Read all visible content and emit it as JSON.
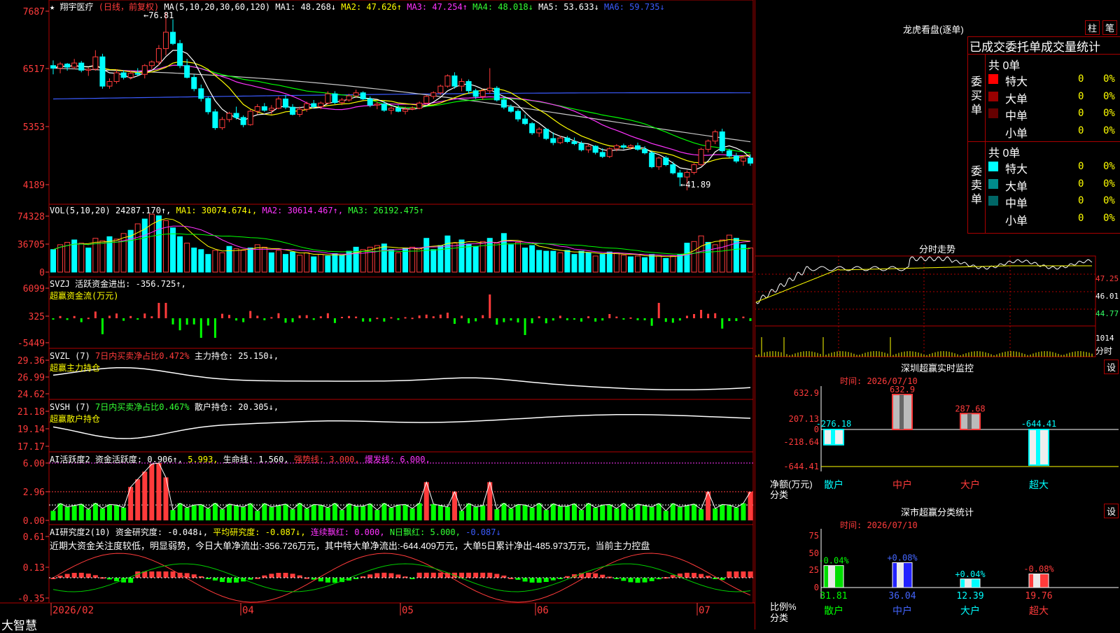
{
  "stock": {
    "name": "翔宇医疗",
    "period": "(日线，前复权)",
    "ma_label": "MA(5,10,20,30,60,120)",
    "ma1": "MA1: 48.268↓",
    "ma2": "MA2: 47.626↑",
    "ma3": "MA3: 47.254↑",
    "ma4": "MA4: 48.018↓",
    "ma5": "MA5: 53.633↓",
    "ma6": "MA6: 59.735↓",
    "high_mark": "←76.81",
    "low_mark": "←41.89"
  },
  "ui": {
    "axis_labels": {
      "price": [
        "7687",
        "6517",
        "5353",
        "4189"
      ],
      "vol": [
        "74328",
        "36705",
        "0"
      ],
      "svzj": [
        "6099",
        "325",
        "-5449"
      ],
      "svzl": [
        "29.36",
        "26.99",
        "24.62"
      ],
      "svsh": [
        "21.18",
        "19.14",
        "17.17"
      ],
      "ai1": [
        "6.00",
        "2.96",
        "0.00"
      ],
      "ai2": [
        "0.61",
        "0.13",
        "-0.35"
      ]
    },
    "date_labels": [
      "2026/02",
      "04",
      "05",
      "06",
      "07"
    ],
    "logo": "大智慧"
  },
  "vol_header": {
    "label": "VOL(5,10,20)",
    "val": "24287.170↑,",
    "ma1": "MA1: 30074.674↓,",
    "ma2": "MA2: 30614.467↑,",
    "ma3": "MA3: 26192.475↑"
  },
  "svzj_header": {
    "label": "SVZJ",
    "text": "活跃资金进出: -356.725↑,",
    "sub": "超赢资金流(万元)"
  },
  "svzl_header": {
    "label": "SVZL (7)",
    "ratio": "7日内买卖净占比0.472%",
    "text": "主力持仓: 25.150↓,",
    "sub": "超赢主力持仓"
  },
  "svsh_header": {
    "label": "SVSH (7)",
    "ratio": "7日内买卖净占比0.467%",
    "text": "散户持仓: 20.305↓,",
    "sub": "超赢散户持仓"
  },
  "ai1_header": {
    "label": "AI活跃度2",
    "text": "资金活跃度: 0.906↑,",
    "val2": "5.993,",
    "life": "生命线: 1.560,",
    "strong": "强势线: 3.000,",
    "burst": "爆发线: 6.000,"
  },
  "ai2_header": {
    "label": "AI研究度2(10)",
    "text": "资金研究度: -0.048↓,",
    "avg": "平均研究度: -0.087↓,",
    "lx": "连续飘红: 0.000,",
    "nd": "N日飘红: 5.000,",
    "last": "-0.087↓",
    "comment": "近期大资金关注度较低，明显弱势，今日大单净流出:-356.726万元，其中特大单净流出:-644.409万元，大单5日累计净出-485.973万元，当前主力控盘"
  },
  "right": {
    "lhkp": "龙虎看盘(逐单)",
    "btn_zhu": "柱",
    "btn_bi": "笔",
    "tabs_title": "已成交委托单成交量统计",
    "buy": {
      "side": "委买单",
      "total": "共 0单",
      "rows": [
        {
          "label": "特大",
          "val": "0",
          "pct": "0%",
          "color": "#ff0000"
        },
        {
          "label": "大单",
          "val": "0",
          "pct": "0%",
          "color": "#990000"
        },
        {
          "label": "中单",
          "val": "0",
          "pct": "0%",
          "color": "#660000"
        },
        {
          "label": "小单",
          "val": "0",
          "pct": "0%",
          "color": "#000000"
        }
      ]
    },
    "sell": {
      "side": "委卖单",
      "total": "共 0单",
      "rows": [
        {
          "label": "特大",
          "val": "0",
          "pct": "0%",
          "color": "#00ffff"
        },
        {
          "label": "大单",
          "val": "0",
          "pct": "0%",
          "color": "#008b8b"
        },
        {
          "label": "中单",
          "val": "0",
          "pct": "0%",
          "color": "#006666"
        },
        {
          "label": "小单",
          "val": "0",
          "pct": "0%",
          "color": "#000000"
        }
      ]
    },
    "fs": {
      "title": "分时走势",
      "p1": "47.25",
      "p2": "46.01",
      "p3": "44.77",
      "vol": "1014",
      "unit": "分时"
    },
    "monitor": {
      "title": "深圳超赢实时监控",
      "btn": "设",
      "time": "时间: 2026/07/10",
      "axis": [
        "632.9",
        "207.13",
        "0",
        "-218.64",
        "-644.41"
      ],
      "ylabel": "净额(万元)",
      "xlabel": "分类",
      "cats": [
        "散户",
        "中户",
        "大户",
        "超大"
      ],
      "values": [
        -276.18,
        632.9,
        287.68,
        -644.41
      ],
      "labels": [
        "-276.18",
        "632.9",
        "287.68",
        "-644.41"
      ]
    },
    "classify": {
      "title": "深市超赢分类统计",
      "btn": "设",
      "time": "时间: 2026/07/10",
      "axis": [
        "75",
        "50",
        "25",
        "0"
      ],
      "ylabel": "比例%",
      "xlabel": "分类",
      "cats": [
        "散户",
        "中户",
        "大户",
        "超大"
      ],
      "values": [
        31.81,
        36.04,
        12.39,
        19.76
      ],
      "labels": [
        "31.81",
        "36.04",
        "12.39",
        "19.76"
      ],
      "changes": [
        "-0.04%",
        "+0.08%",
        "+0.04%",
        "-0.08%"
      ]
    }
  },
  "chart_data": {
    "type": "candlestick",
    "ohlc": [
      [
        66.5,
        67.5,
        64.8,
        66.0
      ],
      [
        66.0,
        67.2,
        65.0,
        66.8
      ],
      [
        66.8,
        67.0,
        65.5,
        66.2
      ],
      [
        66.2,
        67.8,
        65.8,
        67.0
      ],
      [
        67.0,
        67.4,
        65.2,
        65.6
      ],
      [
        65.6,
        66.1,
        64.5,
        65.8
      ],
      [
        65.8,
        69.5,
        65.5,
        68.2
      ],
      [
        68.2,
        68.8,
        62.0,
        62.5
      ],
      [
        62.5,
        64.0,
        62.0,
        63.4
      ],
      [
        63.4,
        65.8,
        63.0,
        65.1
      ],
      [
        65.1,
        65.6,
        63.8,
        64.2
      ],
      [
        64.2,
        65.5,
        63.8,
        65.0
      ],
      [
        65.0,
        66.0,
        64.5,
        64.8
      ],
      [
        64.8,
        66.8,
        64.0,
        66.5
      ],
      [
        66.5,
        67.5,
        65.8,
        67.2
      ],
      [
        67.2,
        70.5,
        66.5,
        69.8
      ],
      [
        69.8,
        76.81,
        68.5,
        73.0
      ],
      [
        73.0,
        75.5,
        70.5,
        70.8
      ],
      [
        70.8,
        71.5,
        66.0,
        66.5
      ],
      [
        66.5,
        67.8,
        64.0,
        64.2
      ],
      [
        64.2,
        64.8,
        61.5,
        62.0
      ],
      [
        62.0,
        62.8,
        59.5,
        60.1
      ],
      [
        60.1,
        60.5,
        57.0,
        57.5
      ],
      [
        57.5,
        58.0,
        54.0,
        54.4
      ],
      [
        54.4,
        56.5,
        54.0,
        56.0
      ],
      [
        56.0,
        57.5,
        55.5,
        57.2
      ],
      [
        57.2,
        58.5,
        56.0,
        56.4
      ],
      [
        56.4,
        56.8,
        54.5,
        55.0
      ],
      [
        55.0,
        58.0,
        54.8,
        57.6
      ],
      [
        57.6,
        59.0,
        57.0,
        58.5
      ],
      [
        58.5,
        59.2,
        57.5,
        57.8
      ],
      [
        57.8,
        58.8,
        57.0,
        58.2
      ],
      [
        58.2,
        60.5,
        58.0,
        60.0
      ],
      [
        60.0,
        60.8,
        58.0,
        58.4
      ],
      [
        58.4,
        59.0,
        56.8,
        57.0
      ],
      [
        57.0,
        58.5,
        56.5,
        58.0
      ],
      [
        58.0,
        59.5,
        57.5,
        59.1
      ],
      [
        59.1,
        59.8,
        58.2,
        58.5
      ],
      [
        58.5,
        59.5,
        58.0,
        59.2
      ],
      [
        59.2,
        61.5,
        59.0,
        61.0
      ],
      [
        61.0,
        61.5,
        59.0,
        59.3
      ],
      [
        59.3,
        60.2,
        58.8,
        59.8
      ],
      [
        59.8,
        61.0,
        59.5,
        60.6
      ],
      [
        60.6,
        61.8,
        60.2,
        61.2
      ],
      [
        61.2,
        61.5,
        59.8,
        60.0
      ],
      [
        60.0,
        60.5,
        58.4,
        58.8
      ],
      [
        58.8,
        59.5,
        58.0,
        59.0
      ],
      [
        59.0,
        59.6,
        57.5,
        57.8
      ],
      [
        57.8,
        58.5,
        57.0,
        58.2
      ],
      [
        58.2,
        58.8,
        57.4,
        57.6
      ],
      [
        57.6,
        58.5,
        57.0,
        58.0
      ],
      [
        58.0,
        58.6,
        57.8,
        58.2
      ],
      [
        58.2,
        59.5,
        58.0,
        59.2
      ],
      [
        59.2,
        60.8,
        59.0,
        60.5
      ],
      [
        60.5,
        61.5,
        60.0,
        61.2
      ],
      [
        61.2,
        62.8,
        60.8,
        62.5
      ],
      [
        62.5,
        64.8,
        62.2,
        64.5
      ],
      [
        64.5,
        65.2,
        62.0,
        62.5
      ],
      [
        62.5,
        64.0,
        61.5,
        63.4
      ],
      [
        63.4,
        63.8,
        61.0,
        61.6
      ],
      [
        61.6,
        62.0,
        60.0,
        60.5
      ],
      [
        60.5,
        62.0,
        59.8,
        61.6
      ],
      [
        61.6,
        66.0,
        61.0,
        62.1
      ],
      [
        62.1,
        62.5,
        59.5,
        59.8
      ],
      [
        59.8,
        60.5,
        58.0,
        58.4
      ],
      [
        58.4,
        58.9,
        57.3,
        57.6
      ],
      [
        57.6,
        58.0,
        55.6,
        56.1
      ],
      [
        56.1,
        57.0,
        54.9,
        55.2
      ],
      [
        55.2,
        55.5,
        53.0,
        53.4
      ],
      [
        53.4,
        54.5,
        52.6,
        54.1
      ],
      [
        54.1,
        54.3,
        52.0,
        52.3
      ],
      [
        52.3,
        53.5,
        51.0,
        51.5
      ],
      [
        51.5,
        52.8,
        51.2,
        52.4
      ],
      [
        52.4,
        52.8,
        51.4,
        51.7
      ],
      [
        51.7,
        52.5,
        51.0,
        51.3
      ],
      [
        51.3,
        51.8,
        49.8,
        50.1
      ],
      [
        50.1,
        51.2,
        49.5,
        50.8
      ],
      [
        50.8,
        51.0,
        49.2,
        49.6
      ],
      [
        49.6,
        50.4,
        48.5,
        48.8
      ],
      [
        48.8,
        50.6,
        48.5,
        50.3
      ],
      [
        50.3,
        51.2,
        49.8,
        50.9
      ],
      [
        50.9,
        51.3,
        50.2,
        50.6
      ],
      [
        50.6,
        51.2,
        50.1,
        50.9
      ],
      [
        50.9,
        51.5,
        49.9,
        50.2
      ],
      [
        50.2,
        50.8,
        49.2,
        49.5
      ],
      [
        49.5,
        49.9,
        46.5,
        46.8
      ],
      [
        46.8,
        48.8,
        46.2,
        48.5
      ],
      [
        48.5,
        48.9,
        46.9,
        47.2
      ],
      [
        47.2,
        47.8,
        45.3,
        45.6
      ],
      [
        45.6,
        46.2,
        43.0,
        44.8
      ],
      [
        44.8,
        46.1,
        42.2,
        45.7
      ],
      [
        45.7,
        47.5,
        45.3,
        47.2
      ],
      [
        47.2,
        50.5,
        47.0,
        50.2
      ],
      [
        50.2,
        52.1,
        49.6,
        51.8
      ],
      [
        51.8,
        54.0,
        51.2,
        53.6
      ],
      [
        53.6,
        54.2,
        49.5,
        49.9
      ],
      [
        49.9,
        50.3,
        48.5,
        48.9
      ],
      [
        48.9,
        49.5,
        47.5,
        47.9
      ],
      [
        47.9,
        49.0,
        47.0,
        48.5
      ],
      [
        48.5,
        49.2,
        47.0,
        47.5
      ]
    ],
    "volume": [
      {
        "v": 28,
        "up": false
      },
      {
        "v": 34,
        "up": true
      },
      {
        "v": 37,
        "up": true
      },
      {
        "v": 40,
        "up": false
      },
      {
        "v": 36,
        "up": true
      },
      {
        "v": 30,
        "up": false
      },
      {
        "v": 42,
        "up": true
      },
      {
        "v": 39,
        "up": true
      },
      {
        "v": 44,
        "up": false
      },
      {
        "v": 41,
        "up": true
      },
      {
        "v": 48,
        "up": true
      },
      {
        "v": 52,
        "up": false
      },
      {
        "v": 60,
        "up": true
      },
      {
        "v": 66,
        "up": false
      },
      {
        "v": 72,
        "up": true
      },
      {
        "v": 70,
        "up": false
      },
      {
        "v": 64,
        "up": true
      },
      {
        "v": 55,
        "up": false
      },
      {
        "v": 44,
        "up": false
      },
      {
        "v": 36,
        "up": true
      },
      {
        "v": 30,
        "up": false
      },
      {
        "v": 28,
        "up": false
      },
      {
        "v": 22,
        "up": false
      },
      {
        "v": 27,
        "up": true
      },
      {
        "v": 24,
        "up": true
      },
      {
        "v": 32,
        "up": false
      },
      {
        "v": 29,
        "up": true
      },
      {
        "v": 27,
        "up": true
      },
      {
        "v": 30,
        "up": false
      },
      {
        "v": 34,
        "up": true
      },
      {
        "v": 31,
        "up": true
      },
      {
        "v": 24,
        "up": false
      },
      {
        "v": 27,
        "up": true
      },
      {
        "v": 22,
        "up": false
      },
      {
        "v": 25,
        "up": false
      },
      {
        "v": 21,
        "up": true
      },
      {
        "v": 24,
        "up": true
      },
      {
        "v": 19,
        "up": false
      },
      {
        "v": 22,
        "up": true
      },
      {
        "v": 20,
        "up": false
      },
      {
        "v": 23,
        "up": false
      },
      {
        "v": 21,
        "up": false
      },
      {
        "v": 26,
        "up": false
      },
      {
        "v": 31,
        "up": false
      },
      {
        "v": 28,
        "up": true
      },
      {
        "v": 31,
        "up": true
      },
      {
        "v": 33,
        "up": true
      },
      {
        "v": 35,
        "up": false
      },
      {
        "v": 28,
        "up": false
      },
      {
        "v": 24,
        "up": true
      },
      {
        "v": 30,
        "up": false
      },
      {
        "v": 31,
        "up": true
      },
      {
        "v": 30,
        "up": true
      },
      {
        "v": 42,
        "up": false
      },
      {
        "v": 28,
        "up": false
      },
      {
        "v": 33,
        "up": false
      },
      {
        "v": 45,
        "up": false
      },
      {
        "v": 36,
        "up": true
      },
      {
        "v": 40,
        "up": false
      },
      {
        "v": 35,
        "up": false
      },
      {
        "v": 32,
        "up": false
      },
      {
        "v": 38,
        "up": true
      },
      {
        "v": 42,
        "up": false
      },
      {
        "v": 36,
        "up": true
      },
      {
        "v": 48,
        "up": false
      },
      {
        "v": 34,
        "up": false
      },
      {
        "v": 37,
        "up": true
      },
      {
        "v": 30,
        "up": false
      },
      {
        "v": 33,
        "up": false
      },
      {
        "v": 27,
        "up": false
      },
      {
        "v": 26,
        "up": false
      },
      {
        "v": 26,
        "up": false
      },
      {
        "v": 24,
        "up": true
      },
      {
        "v": 27,
        "up": false
      },
      {
        "v": 22,
        "up": false
      },
      {
        "v": 26,
        "up": false
      },
      {
        "v": 24,
        "up": false
      },
      {
        "v": 20,
        "up": true
      },
      {
        "v": 22,
        "up": false
      },
      {
        "v": 25,
        "up": false
      },
      {
        "v": 24,
        "up": true
      },
      {
        "v": 21,
        "up": true
      },
      {
        "v": 19,
        "up": false
      },
      {
        "v": 20,
        "up": true
      },
      {
        "v": 18,
        "up": false
      },
      {
        "v": 22,
        "up": false
      },
      {
        "v": 20,
        "up": true
      },
      {
        "v": 17,
        "up": false
      },
      {
        "v": 20,
        "up": true
      },
      {
        "v": 22,
        "up": false
      },
      {
        "v": 36,
        "up": false
      },
      {
        "v": 38,
        "up": true
      },
      {
        "v": 45,
        "up": true
      },
      {
        "v": 37,
        "up": false
      },
      {
        "v": 34,
        "up": true
      },
      {
        "v": 40,
        "up": true
      },
      {
        "v": 46,
        "up": true
      },
      {
        "v": 42,
        "up": false
      },
      {
        "v": 34,
        "up": false
      },
      {
        "v": 30,
        "up": true
      },
      {
        "v": 24,
        "up": false
      }
    ],
    "x_axis_labels": [
      "2026/02",
      "04",
      "05",
      "06",
      "07"
    ],
    "y_range": [
      41.89,
      76.81
    ]
  }
}
